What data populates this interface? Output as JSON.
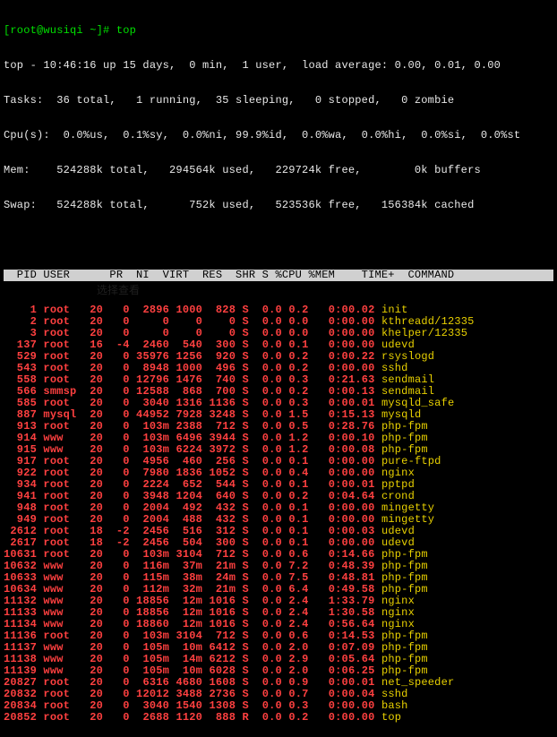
{
  "prompt": "[root@wusiqi ~]# top",
  "summary": {
    "line1": "top - 10:46:16 up 15 days,  0 min,  1 user,  load average: 0.00, 0.01, 0.00",
    "tasks": "Tasks:  36 total,   1 running,  35 sleeping,   0 stopped,   0 zombie",
    "cpu": "Cpu(s):  0.0%us,  0.1%sy,  0.0%ni, 99.9%id,  0.0%wa,  0.0%hi,  0.0%si,  0.0%st",
    "mem": "Mem:    524288k total,   294564k used,   229724k free,        0k buffers",
    "swap": "Swap:   524288k total,      752k used,   523536k free,   156384k cached"
  },
  "header": "  PID USER      PR  NI  VIRT  RES  SHR S %CPU %MEM    TIME+  COMMAND",
  "rows": [
    {
      "pid": "    1",
      "user": "root ",
      "pr": " 20",
      "ni": "  0",
      "virt": " 2896",
      "res": " 1000",
      "shr": "  828",
      "s": " S",
      "cpu": "  0.0",
      "mem": " 0.2",
      "time": "  0:00.02",
      "cmd": "init"
    },
    {
      "pid": "    2",
      "user": "root ",
      "pr": " 20",
      "ni": "  0",
      "virt": "    0",
      "res": "    0",
      "shr": "    0",
      "s": " S",
      "cpu": "  0.0",
      "mem": " 0.0",
      "time": "  0:00.00",
      "cmd": "kthreadd/12335"
    },
    {
      "pid": "    3",
      "user": "root ",
      "pr": " 20",
      "ni": "  0",
      "virt": "    0",
      "res": "    0",
      "shr": "    0",
      "s": " S",
      "cpu": "  0.0",
      "mem": " 0.0",
      "time": "  0:00.00",
      "cmd": "khelper/12335"
    },
    {
      "pid": "  137",
      "user": "root ",
      "pr": " 16",
      "ni": " -4",
      "virt": " 2460",
      "res": "  540",
      "shr": "  300",
      "s": " S",
      "cpu": "  0.0",
      "mem": " 0.1",
      "time": "  0:00.00",
      "cmd": "udevd"
    },
    {
      "pid": "  529",
      "user": "root ",
      "pr": " 20",
      "ni": "  0",
      "virt": "35976",
      "res": " 1256",
      "shr": "  920",
      "s": " S",
      "cpu": "  0.0",
      "mem": " 0.2",
      "time": "  0:00.22",
      "cmd": "rsyslogd"
    },
    {
      "pid": "  543",
      "user": "root ",
      "pr": " 20",
      "ni": "  0",
      "virt": " 8948",
      "res": " 1000",
      "shr": "  496",
      "s": " S",
      "cpu": "  0.0",
      "mem": " 0.2",
      "time": "  0:00.00",
      "cmd": "sshd"
    },
    {
      "pid": "  558",
      "user": "root ",
      "pr": " 20",
      "ni": "  0",
      "virt": "12796",
      "res": " 1476",
      "shr": "  740",
      "s": " S",
      "cpu": "  0.0",
      "mem": " 0.3",
      "time": "  0:21.63",
      "cmd": "sendmail"
    },
    {
      "pid": "  566",
      "user": "smmsp",
      "pr": " 20",
      "ni": "  0",
      "virt": "12588",
      "res": "  868",
      "shr": "  700",
      "s": " S",
      "cpu": "  0.0",
      "mem": " 0.2",
      "time": "  0:00.13",
      "cmd": "sendmail"
    },
    {
      "pid": "  585",
      "user": "root ",
      "pr": " 20",
      "ni": "  0",
      "virt": " 3040",
      "res": " 1316",
      "shr": " 1136",
      "s": " S",
      "cpu": "  0.0",
      "mem": " 0.3",
      "time": "  0:00.01",
      "cmd": "mysqld_safe"
    },
    {
      "pid": "  887",
      "user": "mysql",
      "pr": " 20",
      "ni": "  0",
      "virt": "44952",
      "res": " 7928",
      "shr": " 3248",
      "s": " S",
      "cpu": "  0.0",
      "mem": " 1.5",
      "time": "  0:15.13",
      "cmd": "mysqld"
    },
    {
      "pid": "  913",
      "user": "root ",
      "pr": " 20",
      "ni": "  0",
      "virt": " 103m",
      "res": " 2388",
      "shr": "  712",
      "s": " S",
      "cpu": "  0.0",
      "mem": " 0.5",
      "time": "  0:28.76",
      "cmd": "php-fpm"
    },
    {
      "pid": "  914",
      "user": "www  ",
      "pr": " 20",
      "ni": "  0",
      "virt": " 103m",
      "res": " 6496",
      "shr": " 3944",
      "s": " S",
      "cpu": "  0.0",
      "mem": " 1.2",
      "time": "  0:00.10",
      "cmd": "php-fpm"
    },
    {
      "pid": "  915",
      "user": "www  ",
      "pr": " 20",
      "ni": "  0",
      "virt": " 103m",
      "res": " 6224",
      "shr": " 3972",
      "s": " S",
      "cpu": "  0.0",
      "mem": " 1.2",
      "time": "  0:00.08",
      "cmd": "php-fpm"
    },
    {
      "pid": "  917",
      "user": "root ",
      "pr": " 20",
      "ni": "  0",
      "virt": " 4956",
      "res": "  460",
      "shr": "  256",
      "s": " S",
      "cpu": "  0.0",
      "mem": " 0.1",
      "time": "  0:00.00",
      "cmd": "pure-ftpd"
    },
    {
      "pid": "  922",
      "user": "root ",
      "pr": " 20",
      "ni": "  0",
      "virt": " 7980",
      "res": " 1836",
      "shr": " 1052",
      "s": " S",
      "cpu": "  0.0",
      "mem": " 0.4",
      "time": "  0:00.00",
      "cmd": "nginx"
    },
    {
      "pid": "  934",
      "user": "root ",
      "pr": " 20",
      "ni": "  0",
      "virt": " 2224",
      "res": "  652",
      "shr": "  544",
      "s": " S",
      "cpu": "  0.0",
      "mem": " 0.1",
      "time": "  0:00.01",
      "cmd": "pptpd"
    },
    {
      "pid": "  941",
      "user": "root ",
      "pr": " 20",
      "ni": "  0",
      "virt": " 3948",
      "res": " 1204",
      "shr": "  640",
      "s": " S",
      "cpu": "  0.0",
      "mem": " 0.2",
      "time": "  0:04.64",
      "cmd": "crond"
    },
    {
      "pid": "  948",
      "user": "root ",
      "pr": " 20",
      "ni": "  0",
      "virt": " 2004",
      "res": "  492",
      "shr": "  432",
      "s": " S",
      "cpu": "  0.0",
      "mem": " 0.1",
      "time": "  0:00.00",
      "cmd": "mingetty"
    },
    {
      "pid": "  949",
      "user": "root ",
      "pr": " 20",
      "ni": "  0",
      "virt": " 2004",
      "res": "  488",
      "shr": "  432",
      "s": " S",
      "cpu": "  0.0",
      "mem": " 0.1",
      "time": "  0:00.00",
      "cmd": "mingetty"
    },
    {
      "pid": " 2612",
      "user": "root ",
      "pr": " 18",
      "ni": " -2",
      "virt": " 2456",
      "res": "  516",
      "shr": "  312",
      "s": " S",
      "cpu": "  0.0",
      "mem": " 0.1",
      "time": "  0:00.03",
      "cmd": "udevd"
    },
    {
      "pid": " 2617",
      "user": "root ",
      "pr": " 18",
      "ni": " -2",
      "virt": " 2456",
      "res": "  504",
      "shr": "  300",
      "s": " S",
      "cpu": "  0.0",
      "mem": " 0.1",
      "time": "  0:00.00",
      "cmd": "udevd"
    },
    {
      "pid": "10631",
      "user": "root ",
      "pr": " 20",
      "ni": "  0",
      "virt": " 103m",
      "res": " 3104",
      "shr": "  712",
      "s": " S",
      "cpu": "  0.0",
      "mem": " 0.6",
      "time": "  0:14.66",
      "cmd": "php-fpm"
    },
    {
      "pid": "10632",
      "user": "www  ",
      "pr": " 20",
      "ni": "  0",
      "virt": " 116m",
      "res": "  37m",
      "shr": "  21m",
      "s": " S",
      "cpu": "  0.0",
      "mem": " 7.2",
      "time": "  0:48.39",
      "cmd": "php-fpm"
    },
    {
      "pid": "10633",
      "user": "www  ",
      "pr": " 20",
      "ni": "  0",
      "virt": " 115m",
      "res": "  38m",
      "shr": "  24m",
      "s": " S",
      "cpu": "  0.0",
      "mem": " 7.5",
      "time": "  0:48.81",
      "cmd": "php-fpm"
    },
    {
      "pid": "10634",
      "user": "www  ",
      "pr": " 20",
      "ni": "  0",
      "virt": " 112m",
      "res": "  32m",
      "shr": "  21m",
      "s": " S",
      "cpu": "  0.0",
      "mem": " 6.4",
      "time": "  0:49.58",
      "cmd": "php-fpm"
    },
    {
      "pid": "11132",
      "user": "www  ",
      "pr": " 20",
      "ni": "  0",
      "virt": "18856",
      "res": "  12m",
      "shr": " 1016",
      "s": " S",
      "cpu": "  0.0",
      "mem": " 2.4",
      "time": "  1:33.79",
      "cmd": "nginx"
    },
    {
      "pid": "11133",
      "user": "www  ",
      "pr": " 20",
      "ni": "  0",
      "virt": "18856",
      "res": "  12m",
      "shr": " 1016",
      "s": " S",
      "cpu": "  0.0",
      "mem": " 2.4",
      "time": "  1:30.58",
      "cmd": "nginx"
    },
    {
      "pid": "11134",
      "user": "www  ",
      "pr": " 20",
      "ni": "  0",
      "virt": "18860",
      "res": "  12m",
      "shr": " 1016",
      "s": " S",
      "cpu": "  0.0",
      "mem": " 2.4",
      "time": "  0:56.64",
      "cmd": "nginx"
    },
    {
      "pid": "11136",
      "user": "root ",
      "pr": " 20",
      "ni": "  0",
      "virt": " 103m",
      "res": " 3104",
      "shr": "  712",
      "s": " S",
      "cpu": "  0.0",
      "mem": " 0.6",
      "time": "  0:14.53",
      "cmd": "php-fpm"
    },
    {
      "pid": "11137",
      "user": "www  ",
      "pr": " 20",
      "ni": "  0",
      "virt": " 105m",
      "res": "  10m",
      "shr": " 6412",
      "s": " S",
      "cpu": "  0.0",
      "mem": " 2.0",
      "time": "  0:07.09",
      "cmd": "php-fpm"
    },
    {
      "pid": "11138",
      "user": "www  ",
      "pr": " 20",
      "ni": "  0",
      "virt": " 105m",
      "res": "  14m",
      "shr": " 6212",
      "s": " S",
      "cpu": "  0.0",
      "mem": " 2.9",
      "time": "  0:05.64",
      "cmd": "php-fpm"
    },
    {
      "pid": "11139",
      "user": "www  ",
      "pr": " 20",
      "ni": "  0",
      "virt": " 105m",
      "res": "  10m",
      "shr": " 6028",
      "s": " S",
      "cpu": "  0.0",
      "mem": " 2.0",
      "time": "  0:06.25",
      "cmd": "php-fpm"
    },
    {
      "pid": "20827",
      "user": "root ",
      "pr": " 20",
      "ni": "  0",
      "virt": " 6316",
      "res": " 4680",
      "shr": " 1608",
      "s": " S",
      "cpu": "  0.0",
      "mem": " 0.9",
      "time": "  0:00.01",
      "cmd": "net_speeder"
    },
    {
      "pid": "20832",
      "user": "root ",
      "pr": " 20",
      "ni": "  0",
      "virt": "12012",
      "res": " 3488",
      "shr": " 2736",
      "s": " S",
      "cpu": "  0.0",
      "mem": " 0.7",
      "time": "  0:00.04",
      "cmd": "sshd"
    },
    {
      "pid": "20834",
      "user": "root ",
      "pr": " 20",
      "ni": "  0",
      "virt": " 3040",
      "res": " 1540",
      "shr": " 1308",
      "s": " S",
      "cpu": "  0.0",
      "mem": " 0.3",
      "time": "  0:00.00",
      "cmd": "bash"
    },
    {
      "pid": "20852",
      "user": "root ",
      "pr": " 20",
      "ni": "  0",
      "virt": " 2688",
      "res": " 1120",
      "shr": "  888",
      "s": " R",
      "cpu": "  0.0",
      "mem": " 0.2",
      "time": "  0:00.00",
      "cmd": "top"
    }
  ]
}
